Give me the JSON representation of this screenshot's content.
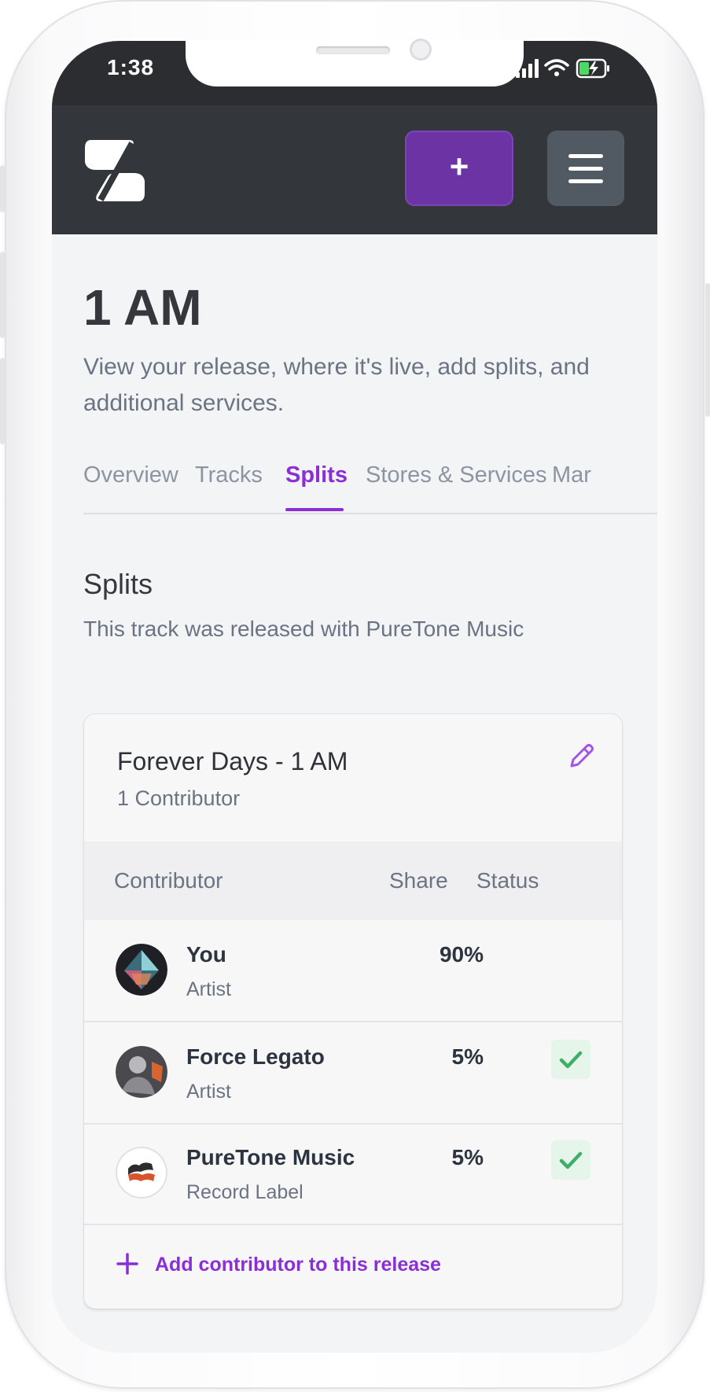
{
  "status_bar": {
    "time": "1:38"
  },
  "header": {
    "add_label": "+"
  },
  "page": {
    "title": "1 AM",
    "description": "View your release, where it's live, add splits, and additional services."
  },
  "tabs": [
    {
      "label": "Overview",
      "active": false
    },
    {
      "label": "Tracks",
      "active": false
    },
    {
      "label": "Splits",
      "active": true
    },
    {
      "label": "Stores & Services",
      "active": false
    },
    {
      "label": "Mar",
      "active": false
    }
  ],
  "splits": {
    "title": "Splits",
    "subtitle": "This track was released with PureTone Music",
    "card": {
      "title": "Forever Days - 1 AM",
      "count": "1 Contributor",
      "columns": {
        "contributor": "Contributor",
        "share": "Share",
        "status": "Status"
      },
      "rows": [
        {
          "name": "You",
          "role": "Artist",
          "share": "90%",
          "status": ""
        },
        {
          "name": "Force Legato",
          "role": "Artist",
          "share": "5%",
          "status": "accepted"
        },
        {
          "name": "PureTone Music",
          "role": "Record Label",
          "share": "5%",
          "status": "accepted"
        }
      ],
      "add_label": "Add contributor to this release"
    }
  },
  "colors": {
    "accent": "#8a2fd8",
    "add_button": "#6b33a4",
    "navbar": "#33373b",
    "status_ok": "#3fae68"
  },
  "icons": {
    "logo": "s-logo-icon",
    "add": "plus-icon",
    "menu": "hamburger-menu-icon",
    "edit": "pencil-icon",
    "status": "checkmark-icon",
    "add_contributor": "plus-icon"
  }
}
